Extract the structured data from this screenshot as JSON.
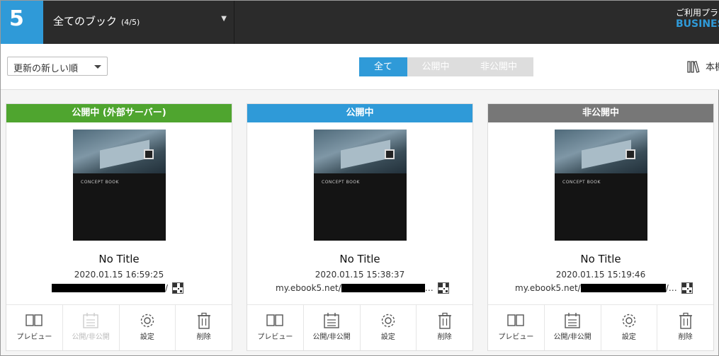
{
  "header": {
    "logo": "5",
    "book_select_title": "全てのブック",
    "book_count": "(4/5)",
    "plan_label": "ご利用プラ",
    "plan_value": "BUSINES"
  },
  "toolbar": {
    "sort_value": "更新の新しい順",
    "filter_tabs": [
      "全て",
      "公開中",
      "非公開中"
    ],
    "active_filter": "全て",
    "shelf_label": "本棚"
  },
  "cards": [
    {
      "status": "公開中 (外部サーバー)",
      "status_color": "#4fa52f",
      "cover_title": "CONCEPT BOOK",
      "title": "No Title",
      "date": "2020.01.15 16:59:25",
      "url_prefix": "",
      "url_suffix": "/",
      "actions": [
        "プレビュー",
        "公開/非公開",
        "設定",
        "削除"
      ],
      "publish_disabled": true
    },
    {
      "status": "公開中",
      "status_color": "#2f9ad8",
      "cover_title": "CONCEPT BOOK",
      "title": "No Title",
      "date": "2020.01.15 15:38:37",
      "url_prefix": "my.ebook5.net/",
      "url_suffix": "…",
      "actions": [
        "プレビュー",
        "公開/非公開",
        "設定",
        "削除"
      ],
      "publish_disabled": false
    },
    {
      "status": "非公開中",
      "status_color": "#777777",
      "cover_title": "CONCEPT BOOK",
      "title": "No Title",
      "date": "2020.01.15 15:19:46",
      "url_prefix": "my.ebook5.net/",
      "url_suffix": "/…",
      "actions": [
        "プレビュー",
        "公開/非公開",
        "設定",
        "削除"
      ],
      "publish_disabled": false
    }
  ]
}
